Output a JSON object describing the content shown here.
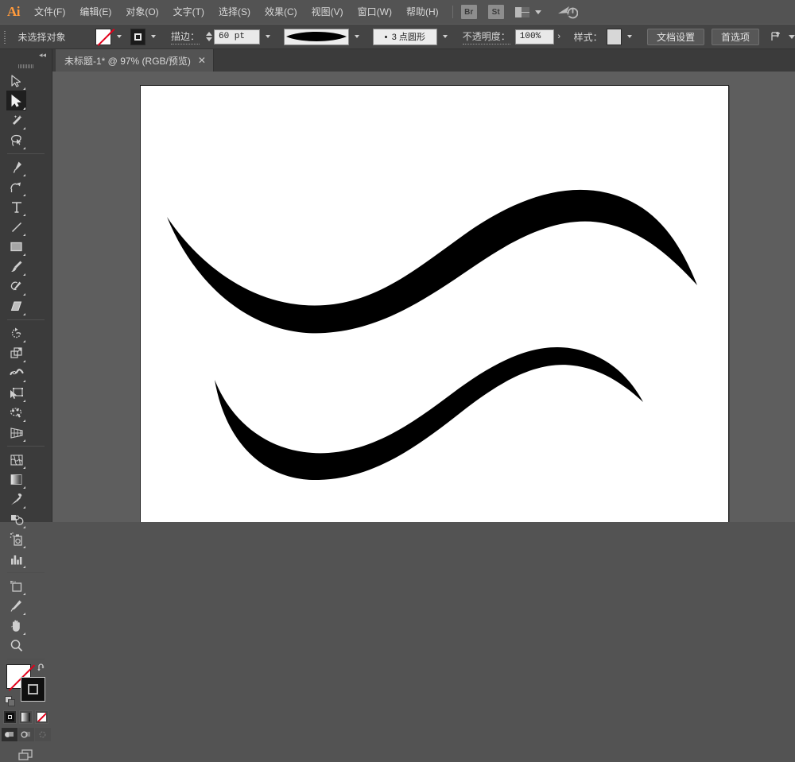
{
  "app": {
    "name": "Ai",
    "logo_text": "Ai"
  },
  "menubar": {
    "items": [
      {
        "label": "文件(F)",
        "name": "menu-file"
      },
      {
        "label": "编辑(E)",
        "name": "menu-edit"
      },
      {
        "label": "对象(O)",
        "name": "menu-object"
      },
      {
        "label": "文字(T)",
        "name": "menu-type"
      },
      {
        "label": "选择(S)",
        "name": "menu-select"
      },
      {
        "label": "效果(C)",
        "name": "menu-effect"
      },
      {
        "label": "视图(V)",
        "name": "menu-view"
      },
      {
        "label": "窗口(W)",
        "name": "menu-window"
      },
      {
        "label": "帮助(H)",
        "name": "menu-help"
      }
    ],
    "bridge_badge": "Br",
    "stock_badge": "St",
    "workspace_icon": "workspace-layout-icon",
    "cursor_power_icon": "cursor-power-icon"
  },
  "controlbar": {
    "selection_status": "未选择对象",
    "fill_swatch": "none-swatch",
    "stroke_swatch": "stroke-swatch",
    "stroke_label": "描边：",
    "stroke_weight": "60 pt",
    "brush_preview": "tapered-brush-preview",
    "profile_label": "3 点圆形",
    "opacity_label": "不透明度：",
    "opacity_value": "100%",
    "style_label": "样式：",
    "style_swatch": "graphic-style-swatch",
    "document_setup": "文档设置",
    "preferences": "首选项",
    "align_icon": "align-to-icon"
  },
  "tabbar": {
    "tab_title": "未标题-1* @ 97% (RGB/预览)",
    "close": "✕"
  },
  "toolpanel": {
    "collapse_icon": "◂◂",
    "tools": [
      {
        "name": "tool-direct-selection",
        "label": "直接选择工具",
        "active": false
      },
      {
        "name": "tool-selection",
        "label": "选择工具",
        "active": true
      },
      {
        "name": "tool-magic-wand",
        "label": "魔棒工具",
        "active": false
      },
      {
        "name": "tool-lasso",
        "label": "套索工具",
        "active": false
      },
      {
        "name": "tool-pen",
        "label": "钢笔工具",
        "active": false
      },
      {
        "name": "tool-curvature",
        "label": "曲率工具",
        "active": false
      },
      {
        "name": "tool-type",
        "label": "文字工具",
        "active": false
      },
      {
        "name": "tool-line-segment",
        "label": "直线段工具",
        "active": false
      },
      {
        "name": "tool-rectangle",
        "label": "矩形工具",
        "active": false
      },
      {
        "name": "tool-paintbrush",
        "label": "画笔工具",
        "active": false
      },
      {
        "name": "tool-shaper",
        "label": "Shaper 工具",
        "active": false
      },
      {
        "name": "tool-eraser",
        "label": "橡皮擦工具",
        "active": false
      },
      {
        "name": "tool-rotate",
        "label": "旋转工具",
        "active": false
      },
      {
        "name": "tool-scale",
        "label": "比例缩放工具",
        "active": false
      },
      {
        "name": "tool-width",
        "label": "宽度工具",
        "active": false
      },
      {
        "name": "tool-free-transform",
        "label": "自由变换工具",
        "active": false
      },
      {
        "name": "tool-puppet-warp",
        "label": "操控变形工具",
        "active": false
      },
      {
        "name": "tool-perspective-grid",
        "label": "透视网格工具",
        "active": false
      },
      {
        "name": "tool-shape-builder",
        "label": "形状生成器工具",
        "active": false
      },
      {
        "name": "tool-gradient",
        "label": "渐变工具",
        "active": false
      },
      {
        "name": "tool-eyedropper",
        "label": "吸管工具",
        "active": false
      },
      {
        "name": "tool-blend",
        "label": "混合工具",
        "active": false
      },
      {
        "name": "tool-symbol-sprayer",
        "label": "符号喷枪工具",
        "active": false
      },
      {
        "name": "tool-column-graph",
        "label": "柱形图工具",
        "active": false
      },
      {
        "name": "tool-artboard",
        "label": "画板工具",
        "active": false
      },
      {
        "name": "tool-slice",
        "label": "切片工具",
        "active": false
      },
      {
        "name": "tool-hand",
        "label": "抓手工具",
        "active": false
      },
      {
        "name": "tool-zoom",
        "label": "缩放工具",
        "active": false
      }
    ],
    "fill_swatch": "none-fill-swatch",
    "stroke_swatch": "black-stroke-swatch",
    "swap_icon": "swap-fill-stroke-icon",
    "default_icon": "default-fill-stroke-icon",
    "color_mode": "color-button",
    "gradient_mode": "gradient-button",
    "none_mode": "none-button",
    "draw_normal": "draw-normal-button",
    "draw_behind": "draw-behind-button",
    "draw_inside": "draw-inside-button",
    "screen_mode": "change-screen-mode-button"
  },
  "canvas": {
    "background_color": "#5e5e5e",
    "artboard_color": "#ffffff",
    "zoom": "97%",
    "artwork": [
      {
        "name": "brush-stroke-upper",
        "description": "锥形 S 形画笔描边（上）",
        "fill": "#000000"
      },
      {
        "name": "brush-stroke-lower",
        "description": "锥形 S 形画笔描边（下）",
        "fill": "#000000"
      }
    ]
  }
}
